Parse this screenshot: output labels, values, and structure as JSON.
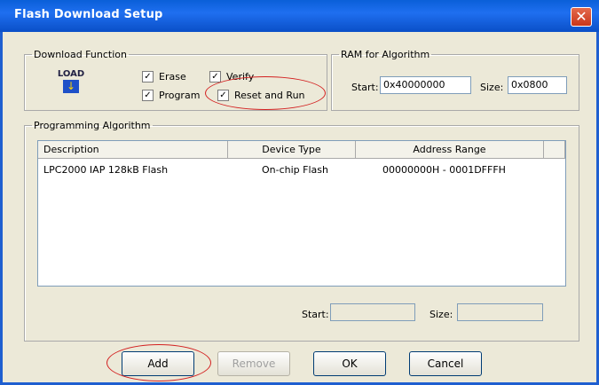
{
  "window": {
    "title": "Flash Download Setup"
  },
  "download_function": {
    "legend": "Download Function",
    "logo_text": "LOAD",
    "options": [
      {
        "label": "Erase",
        "checked": true
      },
      {
        "label": "Verify",
        "checked": true
      },
      {
        "label": "Program",
        "checked": true
      },
      {
        "label": "Reset and Run",
        "checked": true
      }
    ]
  },
  "ram": {
    "legend": "RAM for Algorithm",
    "start_label": "Start:",
    "start_value": "0x40000000",
    "size_label": "Size:",
    "size_value": "0x0800"
  },
  "programming": {
    "legend": "Programming Algorithm",
    "columns": [
      "Description",
      "Device Type",
      "Address Range"
    ],
    "rows": [
      [
        "LPC2000 IAP 128kB Flash",
        "On-chip Flash",
        "00000000H - 0001DFFFH"
      ]
    ],
    "start_label": "Start:",
    "size_label": "Size:"
  },
  "buttons": {
    "add": "Add",
    "remove": "Remove",
    "ok": "OK",
    "cancel": "Cancel"
  },
  "colors": {
    "title_bar": "#0a5fd8",
    "annotation_red": "#d32020",
    "dialog_bg": "#ece9d8"
  }
}
